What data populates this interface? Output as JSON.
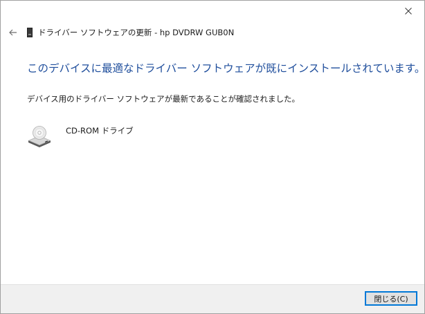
{
  "window": {
    "title": "ドライバー ソフトウェアの更新 - hp DVDRW  GUB0N"
  },
  "main": {
    "heading": "このデバイスに最適なドライバー ソフトウェアが既にインストールされています。",
    "message": "デバイス用のドライバー ソフトウェアが最新であることが確認されました。",
    "device": {
      "label": "CD-ROM ドライブ",
      "icon": "cdrom-drive-icon"
    }
  },
  "footer": {
    "close_label": "閉じる(C)"
  },
  "colors": {
    "heading": "#1f4e9c",
    "footer_bg": "#f0f0f0",
    "button_border": "#0078d7"
  }
}
